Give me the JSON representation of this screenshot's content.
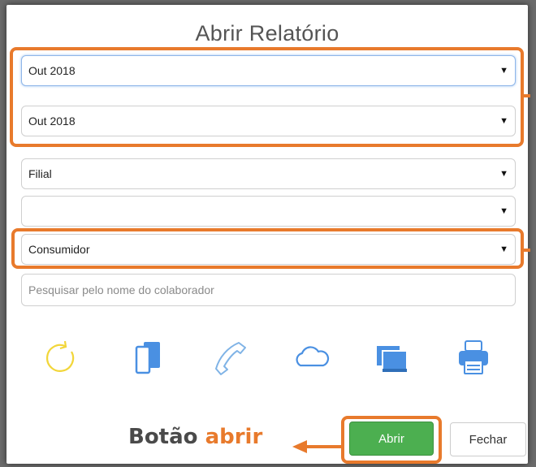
{
  "dialog": {
    "title": "Abrir Relatório"
  },
  "filters": {
    "period_start": "Out 2018",
    "period_end": "Out 2018",
    "branch": "Filial",
    "branch_detail": "",
    "client_type": "Consumidor",
    "dropdown_arrow": "▼"
  },
  "search": {
    "placeholder": "Pesquisar pelo nome do colaborador",
    "value": ""
  },
  "icons": [
    "refresh-icon",
    "devices-icon",
    "phone-icon",
    "cloud-icon",
    "screens-icon",
    "printer-icon"
  ],
  "buttons": {
    "open_label": "Abrir",
    "close_label": "Fechar"
  },
  "annotation": {
    "caption_prefix": "Botão ",
    "caption_accent": "abrir"
  },
  "colors": {
    "highlight": "#e87a2c",
    "open_button": "#4caf50",
    "refresh_icon": "#f2d63a",
    "line_icons": "#7fb3e6",
    "fill_icons": "#4a90e2"
  }
}
